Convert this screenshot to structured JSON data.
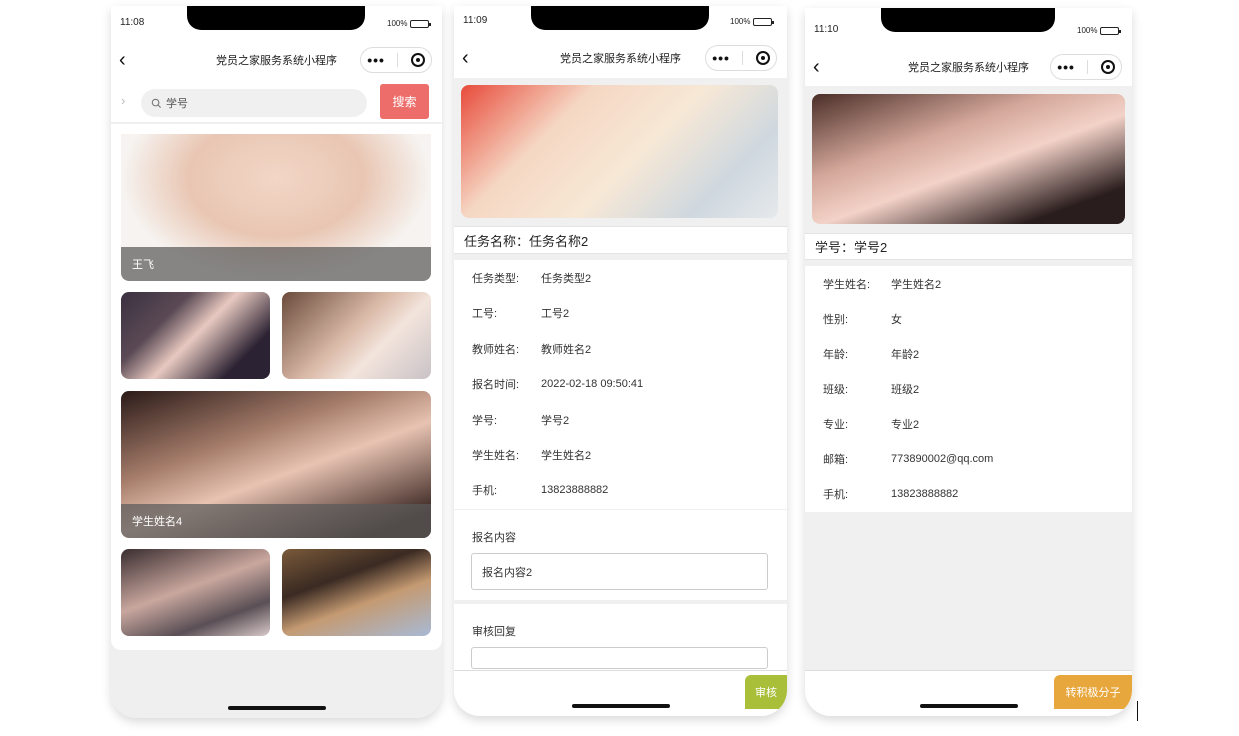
{
  "app_title": "党员之家服务系统小程序",
  "colors": {
    "search_button": "#ec6d6a",
    "audit_button": "#a9bf3a",
    "activist_button": "#e8a73d"
  },
  "screen1": {
    "time": "11:08",
    "battery": "100%",
    "title": "党员之家服务系统小程序",
    "search_placeholder": "学号",
    "search_button": "搜索",
    "cards": [
      {
        "name": "王飞"
      },
      {
        "name": ""
      },
      {
        "name": ""
      },
      {
        "name": "学生姓名4"
      },
      {
        "name": ""
      },
      {
        "name": ""
      }
    ]
  },
  "screen2": {
    "time": "11:09",
    "battery": "100%",
    "title": "党员之家服务系统小程序",
    "task_heading": "任务名称：任务名称2",
    "fields": [
      {
        "label": "任务类型:",
        "value": "任务类型2"
      },
      {
        "label": "工号:",
        "value": "工号2"
      },
      {
        "label": "教师姓名:",
        "value": "教师姓名2"
      },
      {
        "label": "报名时间:",
        "value": "2022-02-18 09:50:41"
      },
      {
        "label": "学号:",
        "value": "学号2"
      },
      {
        "label": "学生姓名:",
        "value": "学生姓名2"
      },
      {
        "label": "手机:",
        "value": "13823888882"
      }
    ],
    "signup_label": "报名内容",
    "signup_value": "报名内容2",
    "reply_label": "审核回复",
    "reply_value": "",
    "audit_button": "审核"
  },
  "screen3": {
    "time": "11:10",
    "battery": "100%",
    "title": "党员之家服务系统小程序",
    "id_heading": "学号：学号2",
    "fields": [
      {
        "label": "学生姓名:",
        "value": "学生姓名2"
      },
      {
        "label": "性别:",
        "value": "女"
      },
      {
        "label": "年龄:",
        "value": "年龄2"
      },
      {
        "label": "班级:",
        "value": "班级2"
      },
      {
        "label": "专业:",
        "value": "专业2"
      },
      {
        "label": "邮箱:",
        "value": "773890002@qq.com"
      },
      {
        "label": "手机:",
        "value": "13823888882"
      }
    ],
    "activist_button": "转积极分子"
  }
}
